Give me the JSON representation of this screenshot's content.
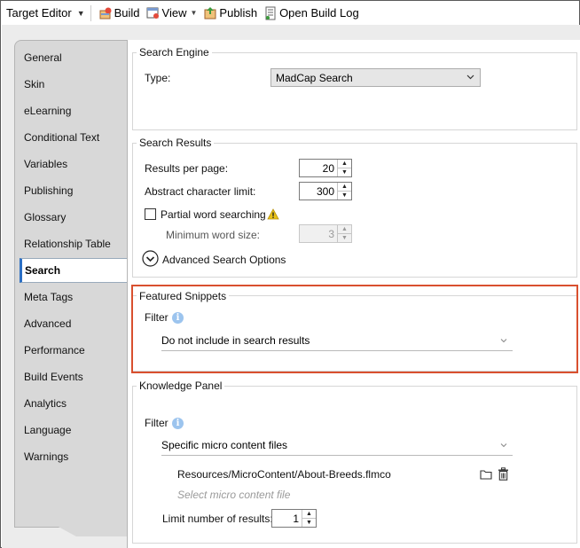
{
  "toolbar": {
    "title": "Target Editor",
    "build_label": "Build",
    "view_label": "View",
    "publish_label": "Publish",
    "open_build_log_label": "Open Build Log"
  },
  "tabs": [
    "General",
    "Skin",
    "eLearning",
    "Conditional Text",
    "Variables",
    "Publishing",
    "Glossary",
    "Relationship Table",
    "Search",
    "Meta Tags",
    "Advanced",
    "Performance",
    "Build Events",
    "Analytics",
    "Language",
    "Warnings"
  ],
  "active_tab": "Search",
  "search_engine": {
    "legend": "Search Engine",
    "type_label": "Type:",
    "type_value": "MadCap Search"
  },
  "search_results": {
    "legend": "Search Results",
    "results_per_page_label": "Results per page:",
    "results_per_page_value": "20",
    "abstract_limit_label": "Abstract character limit:",
    "abstract_limit_value": "300",
    "partial_word_label": "Partial word searching",
    "partial_word_checked": false,
    "min_word_size_label": "Minimum word size:",
    "min_word_size_value": "3",
    "advanced_label": "Advanced Search Options"
  },
  "featured_snippets": {
    "legend": "Featured Snippets",
    "filter_label": "Filter",
    "filter_value": "Do not include in search results"
  },
  "knowledge_panel": {
    "legend": "Knowledge Panel",
    "filter_label": "Filter",
    "filter_value": "Specific micro content files",
    "file_path": "Resources/MicroContent/About-Breeds.flmco",
    "select_placeholder": "Select micro content file",
    "limit_label": "Limit number of results:",
    "limit_value": "1"
  },
  "colors": {
    "accent": "#2b6fc4",
    "highlight": "#d9502f",
    "info": "#9cc4ee",
    "warning": "#e8c21a"
  }
}
